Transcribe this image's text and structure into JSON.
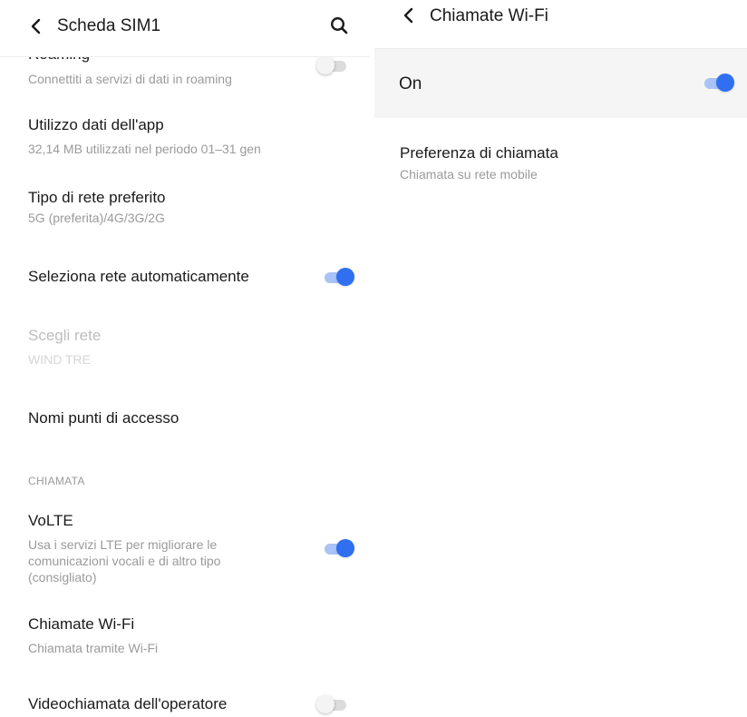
{
  "left_panel": {
    "header": {
      "title": "Scheda SIM1"
    },
    "roaming": {
      "title": "Roaming",
      "subtitle": "Connettiti a servizi di dati in roaming",
      "enabled": false
    },
    "app_data_usage": {
      "title": "Utilizzo dati dell'app",
      "subtitle": "32,14 MB utilizzati nel periodo 01–31 gen"
    },
    "preferred_network": {
      "title": "Tipo di rete preferito",
      "subtitle": "5G (preferita)/4G/3G/2G"
    },
    "auto_network": {
      "title": "Seleziona rete automaticamente",
      "enabled": true
    },
    "choose_network": {
      "title": "Scegli rete",
      "subtitle": "WIND TRE",
      "disabled": true
    },
    "apn": {
      "title": "Nomi punti di accesso"
    },
    "section_calls": {
      "label": "CHIAMATA"
    },
    "volte": {
      "title": "VoLTE",
      "subtitle_lines": [
        "Usa i servizi LTE per migliorare le",
        "comunicazioni vocali e di altro tipo",
        "(consigliato)"
      ],
      "enabled": true
    },
    "wifi_calling": {
      "title": "Chiamate Wi-Fi",
      "subtitle": "Chiamata tramite Wi-Fi"
    },
    "carrier_video": {
      "title": "Videochiamata dell'operatore",
      "enabled": false
    }
  },
  "right_panel": {
    "header": {
      "title": "Chiamate Wi-Fi"
    },
    "main_switch": {
      "label": "On",
      "enabled": true
    },
    "call_preference": {
      "title": "Preferenza di chiamata",
      "subtitle": "Chiamata su rete mobile"
    }
  },
  "colors": {
    "accent": "#2f6ff0",
    "accent_track": "#a9c2f7",
    "off_track": "#dcdcdc",
    "secondary_text": "#9a9a9a",
    "disabled_text": "#bdbdbd",
    "highlight_row": "#f5f5f5"
  },
  "icons": {
    "back": "chevron-left-icon",
    "search": "search-icon"
  }
}
